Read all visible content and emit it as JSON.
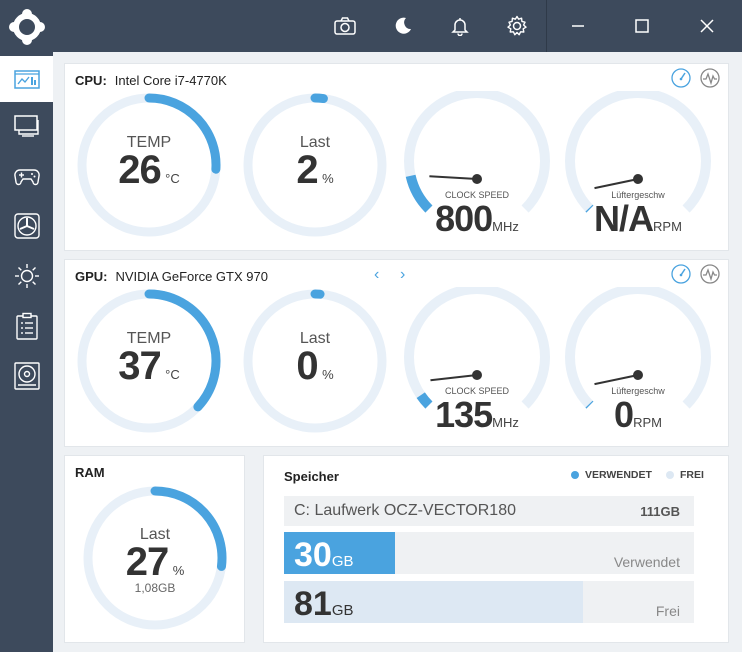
{
  "titlebar": {
    "icons": [
      "app-logo-icon",
      "camera-icon",
      "moon-icon",
      "bell-icon",
      "gear-icon",
      "minimize-icon",
      "maximize-icon",
      "close-icon"
    ]
  },
  "sidebar": {
    "items": [
      {
        "icon": "dashboard-icon",
        "active": true
      },
      {
        "icon": "monitor-icon",
        "active": false
      },
      {
        "icon": "gamepad-icon",
        "active": false
      },
      {
        "icon": "fan-icon",
        "active": false
      },
      {
        "icon": "brightness-icon",
        "active": false
      },
      {
        "icon": "clipboard-icon",
        "active": false
      },
      {
        "icon": "disk-icon",
        "active": false
      }
    ]
  },
  "cpu": {
    "label": "CPU:",
    "name": "Intel Core i7-4770K",
    "temp": {
      "label": "TEMP",
      "value": "26",
      "unit": "°C",
      "fraction": 0.26
    },
    "load": {
      "label": "Last",
      "value": "2",
      "unit": "%",
      "fraction": 0.02
    },
    "clock": {
      "label": "CLOCK SPEED",
      "value": "800",
      "unit": "MHz",
      "fraction": 0.12
    },
    "fan": {
      "label": "Lüftergeschw",
      "value": "N/A",
      "unit": "RPM",
      "fraction": 0.0
    }
  },
  "gpu": {
    "label": "GPU:",
    "name": "NVIDIA GeForce GTX 970",
    "nav_prev": "‹",
    "nav_next": "›",
    "temp": {
      "label": "TEMP",
      "value": "37",
      "unit": "°C",
      "fraction": 0.37
    },
    "load": {
      "label": "Last",
      "value": "0",
      "unit": "%",
      "fraction": 0.0
    },
    "clock": {
      "label": "CLOCK SPEED",
      "value": "135",
      "unit": "MHz",
      "fraction": 0.04
    },
    "fan": {
      "label": "Lüftergeschw",
      "value": "0",
      "unit": "RPM",
      "fraction": 0.0
    }
  },
  "ram": {
    "title": "RAM",
    "load": {
      "label": "Last",
      "value": "27",
      "unit": "%",
      "sub": "1,08GB",
      "fraction": 0.27
    }
  },
  "storage": {
    "title": "Speicher",
    "legend_used": "VERWENDET",
    "legend_free": "FREI",
    "drive_name": "C: Laufwerk OCZ-VECTOR180",
    "drive_size": "111GB",
    "used": {
      "value": "30",
      "unit": "GB",
      "label": "Verwendet",
      "fraction": 0.27
    },
    "free": {
      "value": "81",
      "unit": "GB",
      "label": "Frei",
      "fraction": 0.73
    }
  },
  "colors": {
    "accent": "#4aa3df",
    "track": "#e8f0f8",
    "dark": "#3d4a5c",
    "free_fill": "#dde8f3"
  }
}
